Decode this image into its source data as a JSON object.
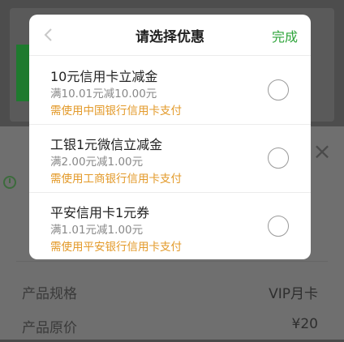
{
  "modal": {
    "title": "请选择优惠",
    "done_label": "完成",
    "coupons": [
      {
        "title": "10元信用卡立减金",
        "condition": "满10.01元减10.00元",
        "note": "需使用中国银行信用卡支付"
      },
      {
        "title": "工银1元微信立减金",
        "condition": "满2.00元减1.00元",
        "note": "需使用工商银行信用卡支付"
      },
      {
        "title": "平安信用卡1元券",
        "condition": "满1.01元减1.00元",
        "note": "需使用平安银行信用卡支付"
      }
    ]
  },
  "background": {
    "close_glyph": "×",
    "rows": [
      {
        "label": "产品规格",
        "value": "VIP月卡"
      },
      {
        "label": "产品原价",
        "value": "¥20"
      }
    ]
  },
  "colors": {
    "accent": "#2ea43a",
    "note": "#e39a2a"
  }
}
